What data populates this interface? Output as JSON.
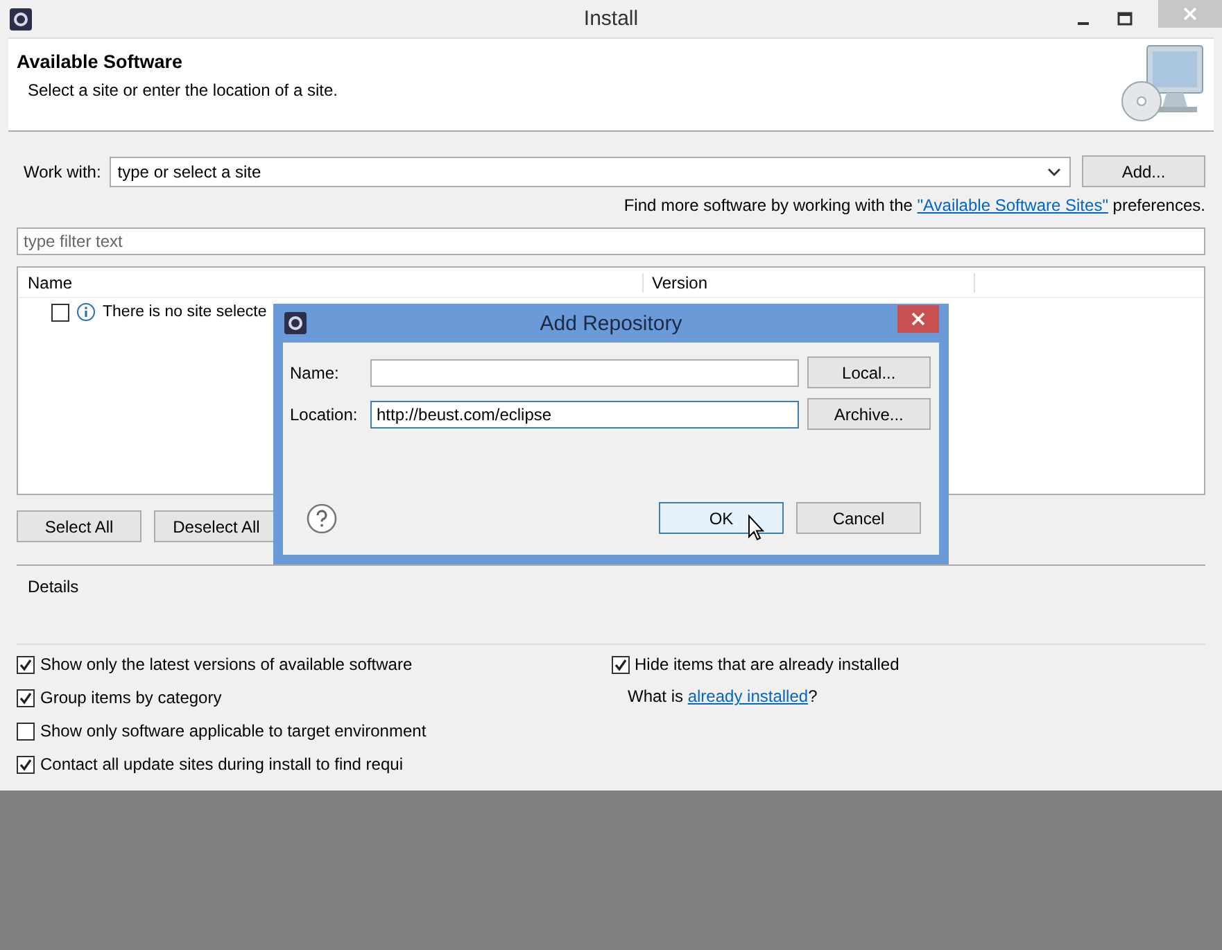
{
  "window": {
    "title": "Install"
  },
  "header": {
    "title": "Available Software",
    "subtitle": "Select a site or enter the location of a site."
  },
  "work_with": {
    "label": "Work with:",
    "value": "type or select a site",
    "button": "Add..."
  },
  "find_more": {
    "prefix": "Find more software by working with the",
    "link": "\"Available Software Sites\"",
    "suffix": "preferences."
  },
  "filter": {
    "placeholder": "type filter text"
  },
  "tree": {
    "columns": [
      "Name",
      "Version"
    ],
    "rows": [
      {
        "text": "There is no site selecte",
        "checked": false
      }
    ]
  },
  "selection_buttons": [
    "Select All",
    "Deselect All"
  ],
  "details": {
    "label": "Details"
  },
  "options_left": [
    {
      "label": "Show only the latest versions of available software",
      "checked": true
    },
    {
      "label": "Group items by category",
      "checked": true
    },
    {
      "label": "Show only software applicable to target environment",
      "checked": false
    },
    {
      "label": "Contact all update sites during install to find requi",
      "checked": true
    }
  ],
  "options_right": [
    {
      "label": "Hide items that are already installed",
      "checked": true
    }
  ],
  "what_is": {
    "prefix": "What is",
    "link": "already installed",
    "suffix": "?"
  },
  "dialog": {
    "title": "Add Repository",
    "fields": [
      {
        "label": "Name:",
        "button": "Local...",
        "focused": false
      },
      {
        "label": "Location:",
        "value": "http://beust.com/eclipse",
        "button": "Archive...",
        "focused": true
      }
    ],
    "ok": "OK",
    "cancel": "Cancel"
  }
}
